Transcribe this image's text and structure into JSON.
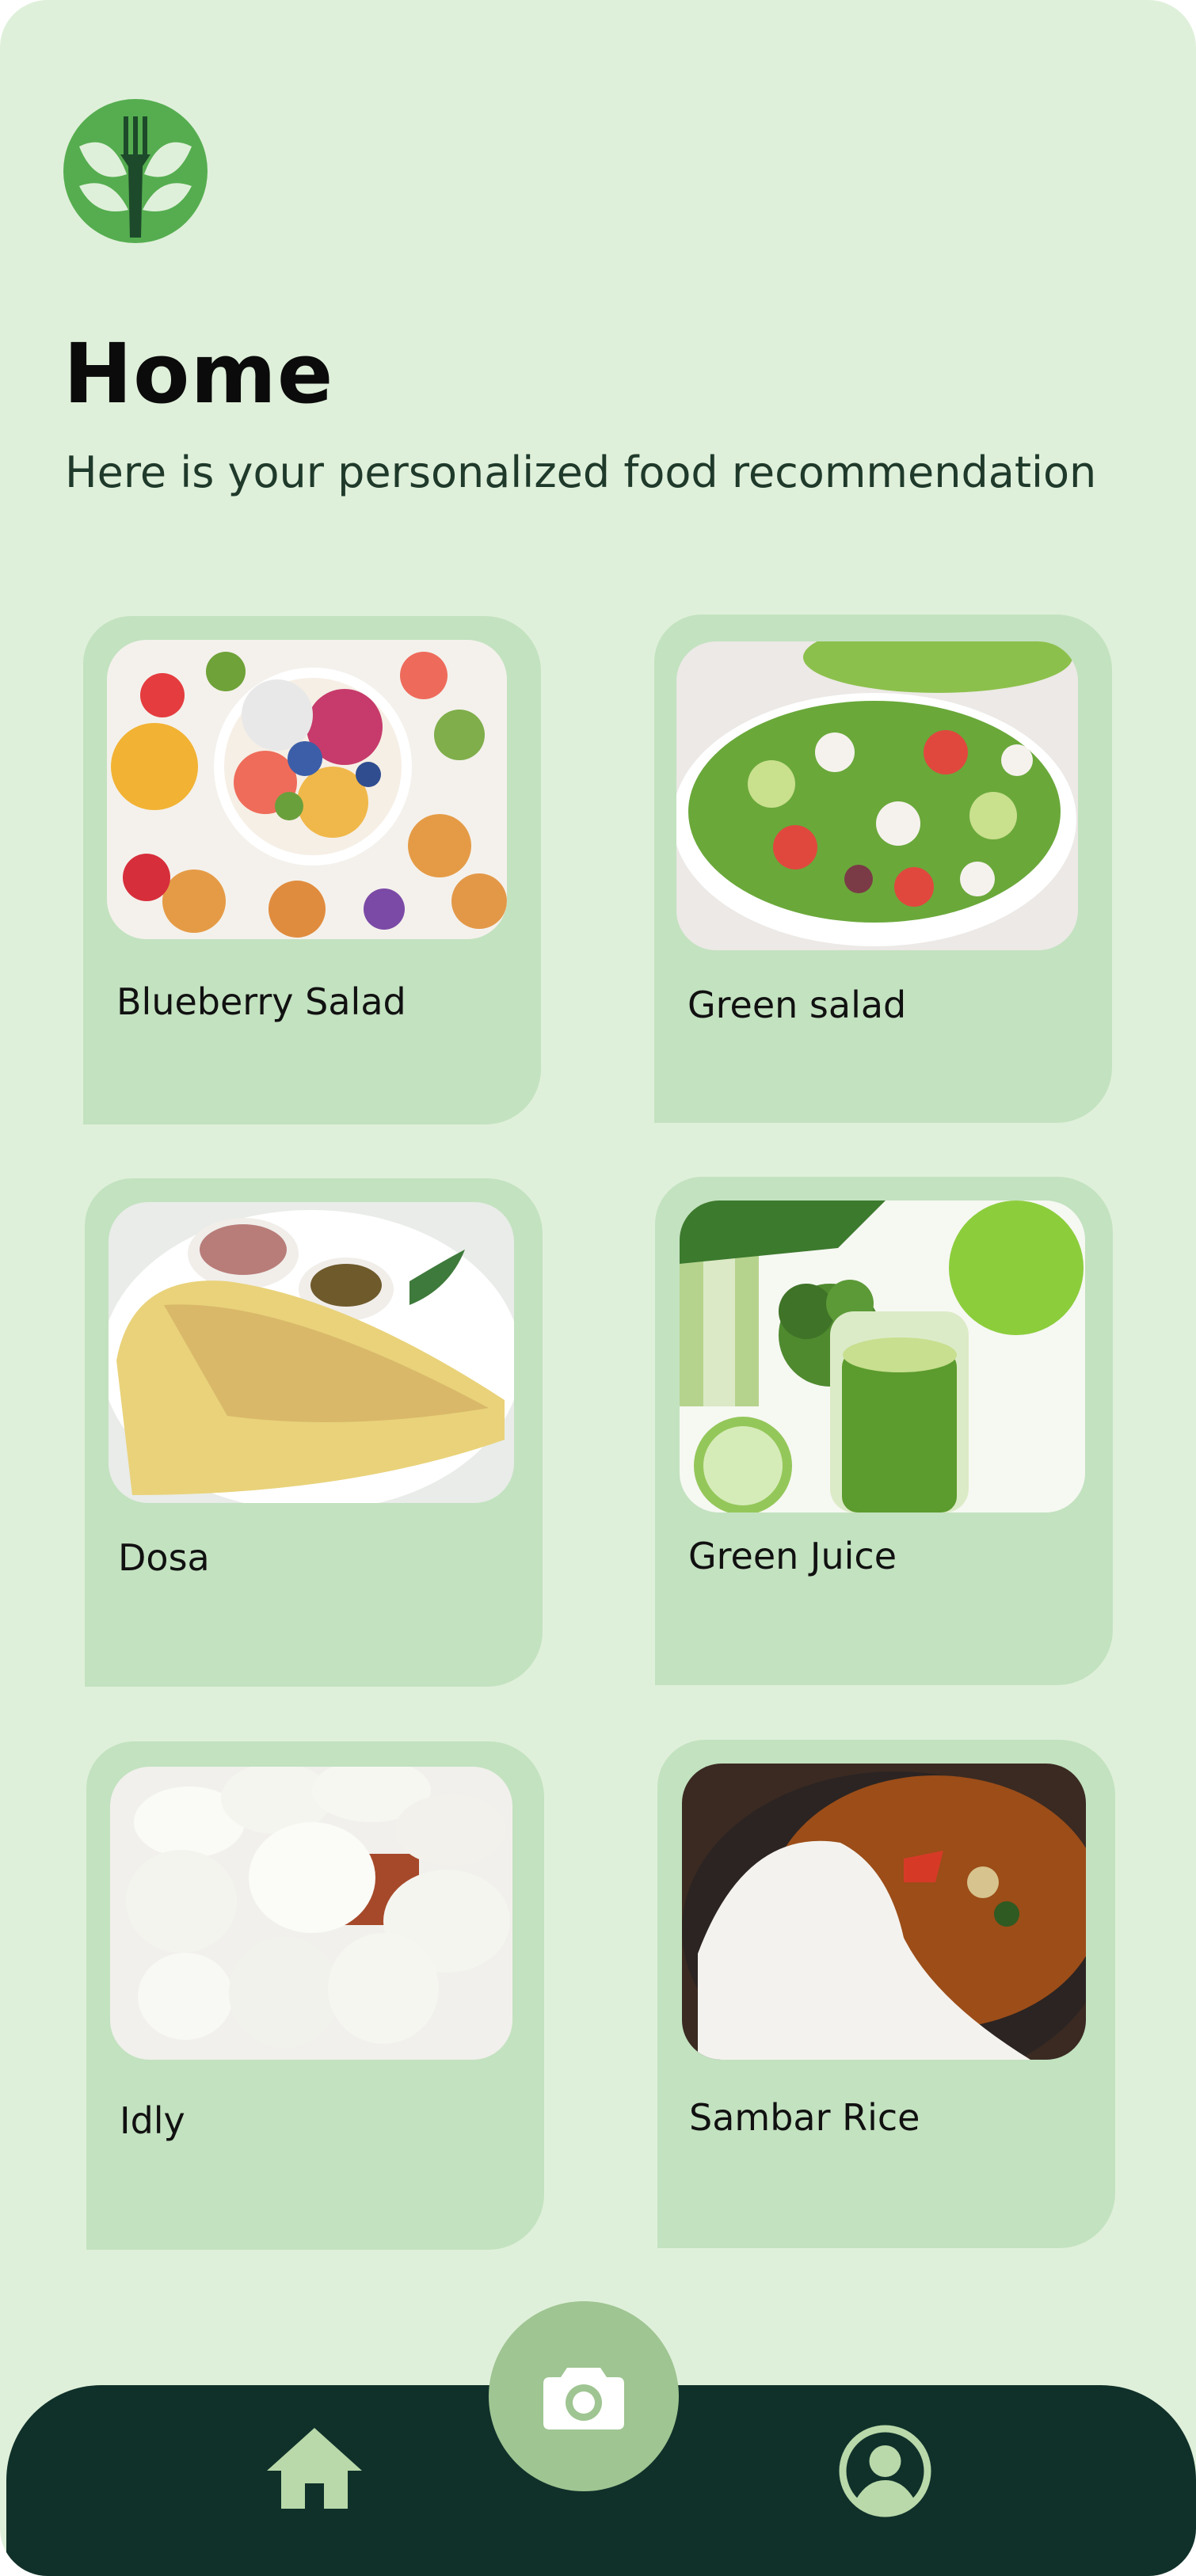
{
  "header": {
    "logo_icon": "tree-fork-logo-icon",
    "title": "Home",
    "subtitle": "Here is your personalized food recommendation"
  },
  "recommendations": [
    {
      "label": "Blueberry Salad",
      "image": "blueberry-salad-photo"
    },
    {
      "label": "Green salad",
      "image": "green-salad-photo"
    },
    {
      "label": "Dosa",
      "image": "dosa-photo"
    },
    {
      "label": "Green Juice",
      "image": "green-juice-photo"
    },
    {
      "label": "Idly",
      "image": "idly-photo"
    },
    {
      "label": "Sambar Rice",
      "image": "sambar-rice-photo"
    }
  ],
  "bottom_nav": {
    "home_icon": "home-icon",
    "camera_icon": "camera-icon",
    "profile_icon": "profile-icon"
  },
  "colors": {
    "background": "#dff0da",
    "card": "#c3e2c0",
    "nav_bar": "#10312a",
    "fab": "#9fc592",
    "nav_icon": "#b9d9aa",
    "logo_green": "#55ad4f"
  }
}
